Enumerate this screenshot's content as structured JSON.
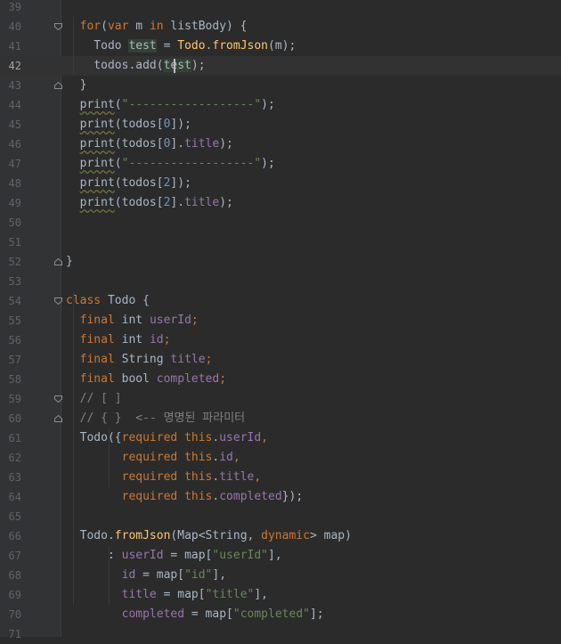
{
  "editor": {
    "current_line": "42",
    "lines": [
      {
        "num": "39",
        "tokens": []
      },
      {
        "num": "40",
        "tokens": [
          [
            "  ",
            "pl"
          ],
          [
            "for",
            "k"
          ],
          [
            "(",
            "pl"
          ],
          [
            "var",
            "k"
          ],
          [
            " m ",
            "pl"
          ],
          [
            "in",
            "k"
          ],
          [
            " listBody) {",
            "pl"
          ]
        ]
      },
      {
        "num": "41",
        "tokens": [
          [
            "    Todo ",
            "pl"
          ],
          [
            "test",
            "hl"
          ],
          [
            " = ",
            "pl"
          ],
          [
            "Todo",
            "ty"
          ],
          [
            ".",
            "pl"
          ],
          [
            "fromJson",
            "f"
          ],
          [
            "(m);",
            "pl"
          ]
        ]
      },
      {
        "num": "42",
        "tokens": [
          [
            "    todos.add(",
            "pl"
          ],
          [
            "test",
            "hl"
          ],
          [
            ");",
            "pl"
          ]
        ]
      },
      {
        "num": "43",
        "tokens": [
          [
            "  }",
            "pl"
          ]
        ]
      },
      {
        "num": "44",
        "tokens": [
          [
            "  ",
            "pl"
          ],
          [
            "print",
            "wavy"
          ],
          [
            "(",
            "pl"
          ],
          [
            "\"------------------\"",
            "s"
          ],
          [
            ");",
            "pl"
          ]
        ]
      },
      {
        "num": "45",
        "tokens": [
          [
            "  ",
            "pl"
          ],
          [
            "print",
            "wavy"
          ],
          [
            "(todos[",
            "pl"
          ],
          [
            "0",
            "n"
          ],
          [
            "]);",
            "pl"
          ]
        ]
      },
      {
        "num": "46",
        "tokens": [
          [
            "  ",
            "pl"
          ],
          [
            "print",
            "wavy"
          ],
          [
            "(todos[",
            "pl"
          ],
          [
            "0",
            "n"
          ],
          [
            "].",
            "pl"
          ],
          [
            "title",
            "fd"
          ],
          [
            ");",
            "pl"
          ]
        ]
      },
      {
        "num": "47",
        "tokens": [
          [
            "  ",
            "pl"
          ],
          [
            "print",
            "wavy"
          ],
          [
            "(",
            "pl"
          ],
          [
            "\"------------------\"",
            "s"
          ],
          [
            ");",
            "pl"
          ]
        ]
      },
      {
        "num": "48",
        "tokens": [
          [
            "  ",
            "pl"
          ],
          [
            "print",
            "wavy"
          ],
          [
            "(todos[",
            "pl"
          ],
          [
            "2",
            "n"
          ],
          [
            "]);",
            "pl"
          ]
        ]
      },
      {
        "num": "49",
        "tokens": [
          [
            "  ",
            "pl"
          ],
          [
            "print",
            "wavy"
          ],
          [
            "(todos[",
            "pl"
          ],
          [
            "2",
            "n"
          ],
          [
            "].",
            "pl"
          ],
          [
            "title",
            "fd"
          ],
          [
            ");",
            "pl"
          ]
        ]
      },
      {
        "num": "50",
        "tokens": []
      },
      {
        "num": "51",
        "tokens": []
      },
      {
        "num": "52",
        "tokens": [
          [
            "}",
            "pl"
          ]
        ]
      },
      {
        "num": "53",
        "tokens": []
      },
      {
        "num": "54",
        "tokens": [
          [
            "class",
            "k"
          ],
          [
            " Todo {",
            "pl"
          ]
        ]
      },
      {
        "num": "55",
        "tokens": [
          [
            "  ",
            "pl"
          ],
          [
            "final",
            "k"
          ],
          [
            " int ",
            "pl"
          ],
          [
            "userId",
            "fd"
          ],
          [
            ";",
            "k"
          ]
        ]
      },
      {
        "num": "56",
        "tokens": [
          [
            "  ",
            "pl"
          ],
          [
            "final",
            "k"
          ],
          [
            " int ",
            "pl"
          ],
          [
            "id",
            "fd"
          ],
          [
            ";",
            "k"
          ]
        ]
      },
      {
        "num": "57",
        "tokens": [
          [
            "  ",
            "pl"
          ],
          [
            "final",
            "k"
          ],
          [
            " String ",
            "pl"
          ],
          [
            "title",
            "fd"
          ],
          [
            ";",
            "k"
          ]
        ]
      },
      {
        "num": "58",
        "tokens": [
          [
            "  ",
            "pl"
          ],
          [
            "final",
            "k"
          ],
          [
            " bool ",
            "pl"
          ],
          [
            "completed",
            "fd"
          ],
          [
            ";",
            "k"
          ]
        ]
      },
      {
        "num": "59",
        "tokens": [
          [
            "  // [ ]",
            "c"
          ]
        ]
      },
      {
        "num": "60",
        "tokens": [
          [
            "  // { }  <-- 명명된 ",
            "c"
          ],
          [
            "파라미터",
            "c"
          ]
        ]
      },
      {
        "num": "61",
        "tokens": [
          [
            "  Todo({",
            "pl"
          ],
          [
            "required",
            "k"
          ],
          [
            " ",
            "pl"
          ],
          [
            "this",
            "k"
          ],
          [
            ".",
            "pl"
          ],
          [
            "userId",
            "fd"
          ],
          [
            ",",
            "k"
          ]
        ]
      },
      {
        "num": "62",
        "tokens": [
          [
            "        ",
            "pl"
          ],
          [
            "required",
            "k"
          ],
          [
            " ",
            "pl"
          ],
          [
            "this",
            "k"
          ],
          [
            ".",
            "pl"
          ],
          [
            "id",
            "fd"
          ],
          [
            ",",
            "k"
          ]
        ]
      },
      {
        "num": "63",
        "tokens": [
          [
            "        ",
            "pl"
          ],
          [
            "required",
            "k"
          ],
          [
            " ",
            "pl"
          ],
          [
            "this",
            "k"
          ],
          [
            ".",
            "pl"
          ],
          [
            "title",
            "fd"
          ],
          [
            ",",
            "k"
          ]
        ]
      },
      {
        "num": "64",
        "tokens": [
          [
            "        ",
            "pl"
          ],
          [
            "required",
            "k"
          ],
          [
            " ",
            "pl"
          ],
          [
            "this",
            "k"
          ],
          [
            ".",
            "pl"
          ],
          [
            "completed",
            "fd"
          ],
          [
            "});",
            "pl"
          ]
        ]
      },
      {
        "num": "65",
        "tokens": []
      },
      {
        "num": "66",
        "tokens": [
          [
            "  Todo.",
            "pl"
          ],
          [
            "fromJson",
            "f"
          ],
          [
            "(Map<String, ",
            "pl"
          ],
          [
            "dynamic",
            "k"
          ],
          [
            "> map)",
            "pl"
          ]
        ]
      },
      {
        "num": "67",
        "tokens": [
          [
            "      : ",
            "pl"
          ],
          [
            "userId",
            "fd"
          ],
          [
            " = map[",
            "pl"
          ],
          [
            "\"userId\"",
            "s"
          ],
          [
            "],",
            "pl"
          ]
        ]
      },
      {
        "num": "68",
        "tokens": [
          [
            "        ",
            "pl"
          ],
          [
            "id",
            "fd"
          ],
          [
            " = map[",
            "pl"
          ],
          [
            "\"id\"",
            "s"
          ],
          [
            "],",
            "pl"
          ]
        ]
      },
      {
        "num": "69",
        "tokens": [
          [
            "        ",
            "pl"
          ],
          [
            "title",
            "fd"
          ],
          [
            " = map[",
            "pl"
          ],
          [
            "\"title\"",
            "s"
          ],
          [
            "],",
            "pl"
          ]
        ]
      },
      {
        "num": "70",
        "tokens": [
          [
            "        ",
            "pl"
          ],
          [
            "completed",
            "fd"
          ],
          [
            " = map[",
            "pl"
          ],
          [
            "\"completed\"",
            "s"
          ],
          [
            "];",
            "pl"
          ]
        ]
      },
      {
        "num": "71",
        "tokens": []
      }
    ]
  }
}
